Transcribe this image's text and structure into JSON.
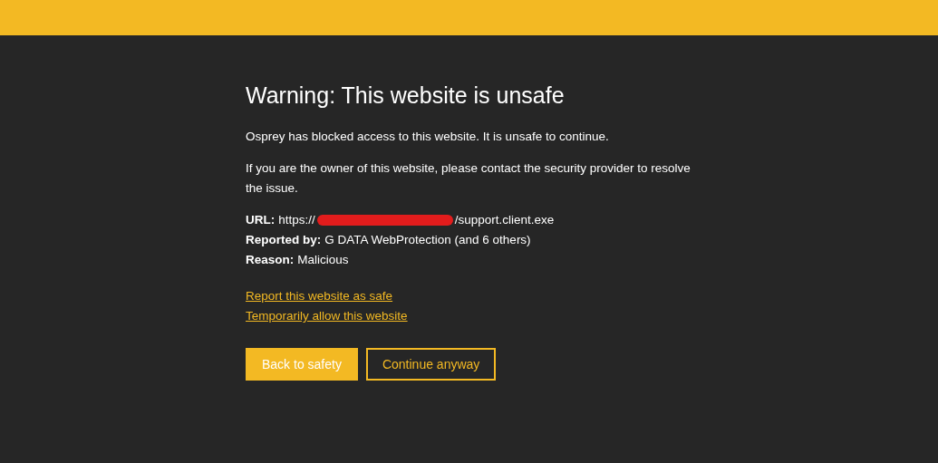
{
  "title": "Warning: This website is unsafe",
  "paragraphs": [
    "Osprey has blocked access to this website. It is unsafe to continue.",
    "If you are the owner of this website, please contact the security provider to resolve the issue."
  ],
  "details": [
    {
      "kind": "redacted",
      "label": "URL:",
      "value_start": "https://",
      "value_end": "/support.client.exe"
    },
    {
      "kind": "plain",
      "label": "Reported by:",
      "value": "G DATA WebProtection (and 6 others)"
    },
    {
      "kind": "plain",
      "label": "Reason:",
      "value": "Malicious"
    }
  ],
  "links": [
    "Report this website as safe",
    "Temporarily allow this website"
  ],
  "buttons": [
    {
      "label": "Back to safety",
      "kind": "primary"
    },
    {
      "label": "Continue anyway",
      "kind": "outline"
    }
  ]
}
